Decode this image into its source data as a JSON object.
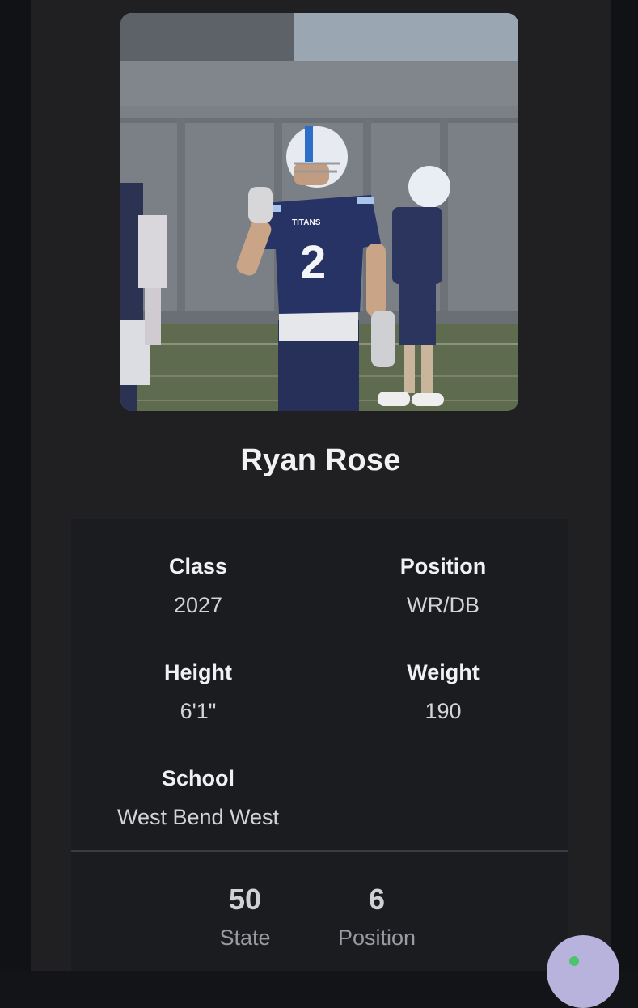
{
  "player": {
    "name": "Ryan Rose",
    "photo_alt": "Football player wearing jersey number 2",
    "jersey_number": "2",
    "jersey_text": "TITANS"
  },
  "attributes": {
    "class_label": "Class",
    "class_value": "2027",
    "position_label": "Position",
    "position_value": "WR/DB",
    "height_label": "Height",
    "height_value": "6'1\"",
    "weight_label": "Weight",
    "weight_value": "190",
    "school_label": "School",
    "school_value": "West Bend West"
  },
  "rankings": {
    "state_number": "50",
    "state_label": "State",
    "position_number": "6",
    "position_label": "Position"
  },
  "icons": {
    "chat": "chat-bubble-icon"
  },
  "colors": {
    "page_bg": "#131417",
    "card_bg": "#202023",
    "panel_bg": "#1b1c1f",
    "chat_bubble": "#b8b3dc",
    "online_dot": "#4cc46d"
  }
}
